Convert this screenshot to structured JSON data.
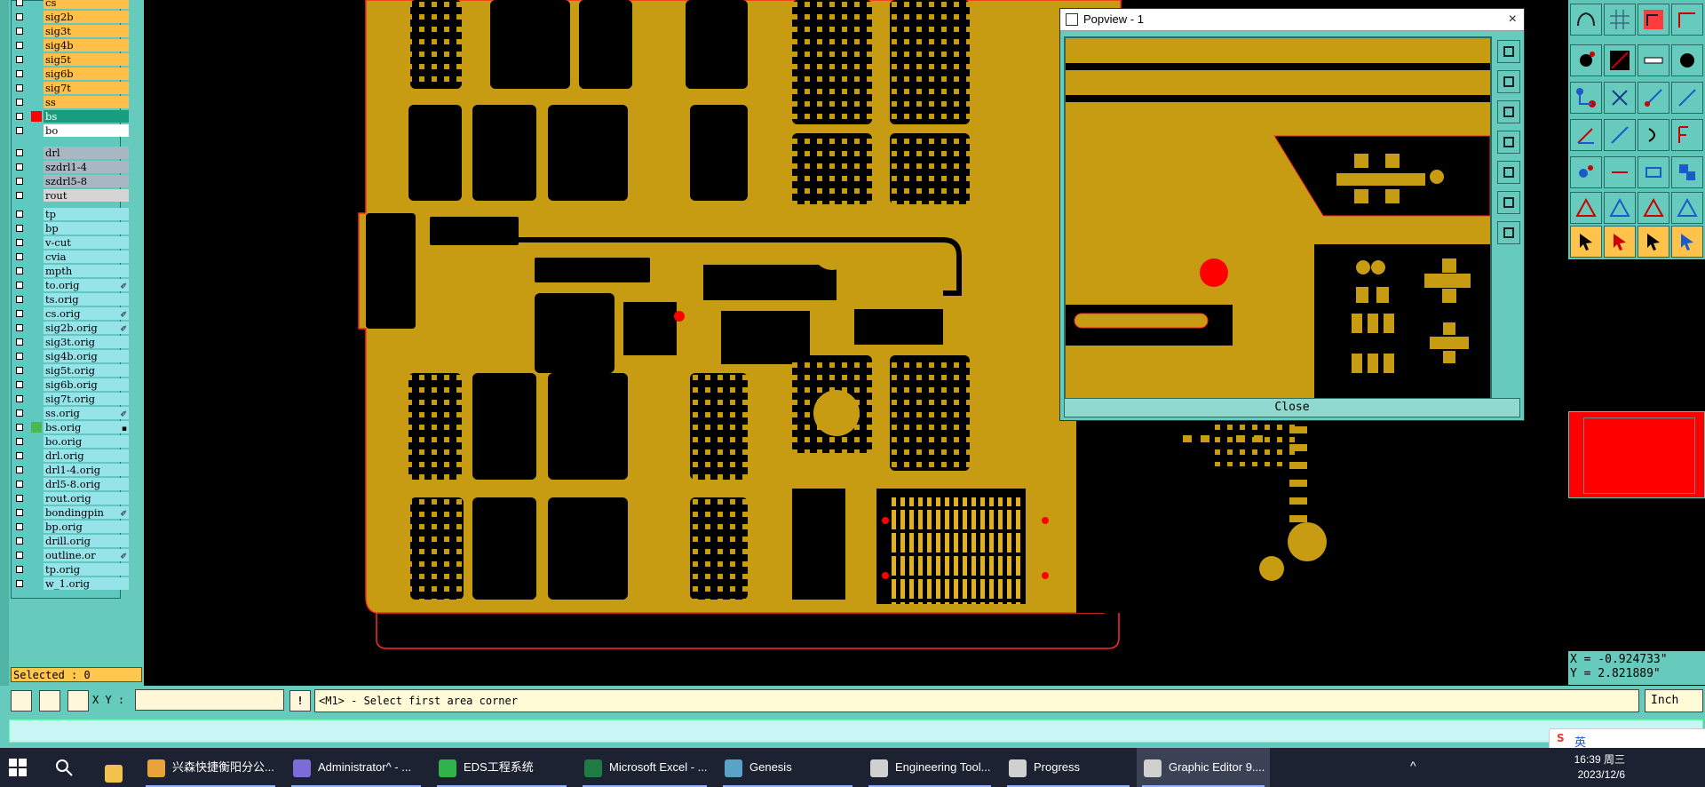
{
  "layers": {
    "group1": [
      {
        "name": "cs",
        "type": "board",
        "mark": ""
      },
      {
        "name": "sig2b",
        "type": "board",
        "mark": ""
      },
      {
        "name": "sig3t",
        "type": "board",
        "mark": ""
      },
      {
        "name": "sig4b",
        "type": "board",
        "mark": ""
      },
      {
        "name": "sig5t",
        "type": "board",
        "mark": ""
      },
      {
        "name": "sig6b",
        "type": "board",
        "mark": ""
      },
      {
        "name": "sig7t",
        "type": "board",
        "mark": ""
      },
      {
        "name": "ss",
        "type": "board",
        "mark": ""
      },
      {
        "name": "bs",
        "type": "sel",
        "mark": ""
      },
      {
        "name": "bo",
        "type": "wht",
        "mark": ""
      }
    ],
    "group2": [
      {
        "name": "drl",
        "type": "drill",
        "mark": ""
      },
      {
        "name": "szdrl1-4",
        "type": "drill",
        "mark": ""
      },
      {
        "name": "szdrl5-8",
        "type": "drill",
        "mark": ""
      },
      {
        "name": "rout",
        "type": "rout",
        "mark": ""
      }
    ],
    "group3": [
      {
        "name": "tp",
        "type": "misc",
        "mark": ""
      },
      {
        "name": "bp",
        "type": "misc",
        "mark": ""
      },
      {
        "name": "v-cut",
        "type": "misc",
        "mark": ""
      },
      {
        "name": "cvia",
        "type": "misc",
        "mark": ""
      },
      {
        "name": "mpth",
        "type": "misc",
        "mark": ""
      },
      {
        "name": "to.orig",
        "type": "misc",
        "mark": "✐"
      },
      {
        "name": "ts.orig",
        "type": "misc",
        "mark": ""
      },
      {
        "name": "cs.orig",
        "type": "misc",
        "mark": "✐"
      },
      {
        "name": "sig2b.orig",
        "type": "misc",
        "mark": "✐"
      },
      {
        "name": "sig3t.orig",
        "type": "misc",
        "mark": ""
      },
      {
        "name": "sig4b.orig",
        "type": "misc",
        "mark": ""
      },
      {
        "name": "sig5t.orig",
        "type": "misc",
        "mark": ""
      },
      {
        "name": "sig6b.orig",
        "type": "misc",
        "mark": ""
      },
      {
        "name": "sig7t.orig",
        "type": "misc",
        "mark": ""
      },
      {
        "name": "ss.orig",
        "type": "misc",
        "mark": "✐"
      },
      {
        "name": "bs.orig",
        "type": "misc",
        "mark": "▪"
      },
      {
        "name": "bo.orig",
        "type": "misc",
        "mark": ""
      },
      {
        "name": "drl.orig",
        "type": "misc",
        "mark": ""
      },
      {
        "name": "drl1-4.orig",
        "type": "misc",
        "mark": ""
      },
      {
        "name": "drl5-8.orig",
        "type": "misc",
        "mark": ""
      },
      {
        "name": "rout.orig",
        "type": "misc",
        "mark": ""
      },
      {
        "name": "bondingpin",
        "type": "misc",
        "mark": "✐"
      },
      {
        "name": "bp.orig",
        "type": "misc",
        "mark": ""
      },
      {
        "name": "drill.orig",
        "type": "misc",
        "mark": ""
      },
      {
        "name": "outline.or",
        "type": "misc",
        "mark": "✐"
      },
      {
        "name": "tp.orig",
        "type": "misc",
        "mark": ""
      },
      {
        "name": "w_1.orig",
        "type": "misc",
        "mark": ""
      }
    ],
    "swatches": {
      "bs": "#ff0000",
      "bs.orig": "#4bb84b"
    }
  },
  "selected_label": "Selected : 0",
  "popview": {
    "title": "Popview - 1",
    "close_button": "Close",
    "close_x": "×"
  },
  "coords": {
    "x": "X = -0.924733\"",
    "y": "Y = 2.821889\""
  },
  "command": {
    "xy_label": "X Y :",
    "xy_value": "",
    "info_label": "!",
    "prompt": "<M1> - Select first area corner",
    "unit": "Inch"
  },
  "taskbar": {
    "apps": [
      {
        "label": "兴森快捷衡阳分公...",
        "color": "#e8a33a"
      },
      {
        "label": "Administrator^ - ...",
        "color": "#7b6cd8"
      },
      {
        "label": "EDS工程系统",
        "color": "#2fb34a"
      },
      {
        "label": "Microsoft Excel - ...",
        "color": "#1f7a43"
      },
      {
        "label": "Genesis",
        "color": "#5aa3c8"
      },
      {
        "label": "Engineering Tool...",
        "color": "#d0d0d0"
      },
      {
        "label": "Progress",
        "color": "#d0d0d0"
      },
      {
        "label": "Graphic Editor 9....",
        "color": "#d0d0d0"
      }
    ],
    "clock_time": "16:39 周三",
    "clock_date": "2023/12/6",
    "ime": "英"
  },
  "colors": {
    "copper": "#c79b12",
    "outline": "#ff2a2a",
    "panel": "#66cbbd"
  }
}
